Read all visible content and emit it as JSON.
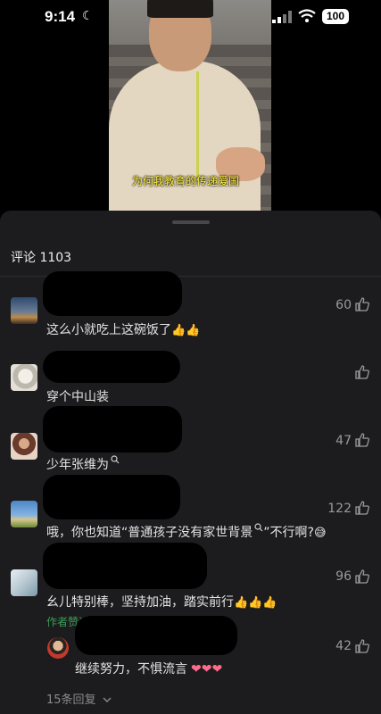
{
  "status_bar": {
    "time": "9:14",
    "battery": "100"
  },
  "video": {
    "subtitle": "为何我教育的传递爱国"
  },
  "comments_header": {
    "title": "评论 1103"
  },
  "comments": [
    {
      "text": "这么小就吃上这碗饭了",
      "emoji": "👍👍",
      "likes": "60"
    },
    {
      "text": "穿个中山装",
      "emoji": "",
      "likes": ""
    },
    {
      "text": "少年张维为",
      "emoji": "",
      "likes": "47"
    },
    {
      "text": "哦，你也知道“普通孩子没有家世背景",
      "text_tail": "”不行啊?",
      "emoji": "😅",
      "likes": "122"
    },
    {
      "text": "幺儿特别棒，坚持加油，踏实前行",
      "emoji": "👍👍👍",
      "likes": "96"
    }
  ],
  "author_tag": "作者赞过",
  "reply": {
    "text": "继续努力，不惧流言",
    "emoji": "❤❤❤",
    "likes": "42"
  },
  "more_replies": "15条回复",
  "icons": [
    "moon-icon",
    "signal-icon",
    "wifi-icon",
    "battery-icon",
    "thumbs-up-icon",
    "search-icon",
    "chevron-down-icon"
  ]
}
